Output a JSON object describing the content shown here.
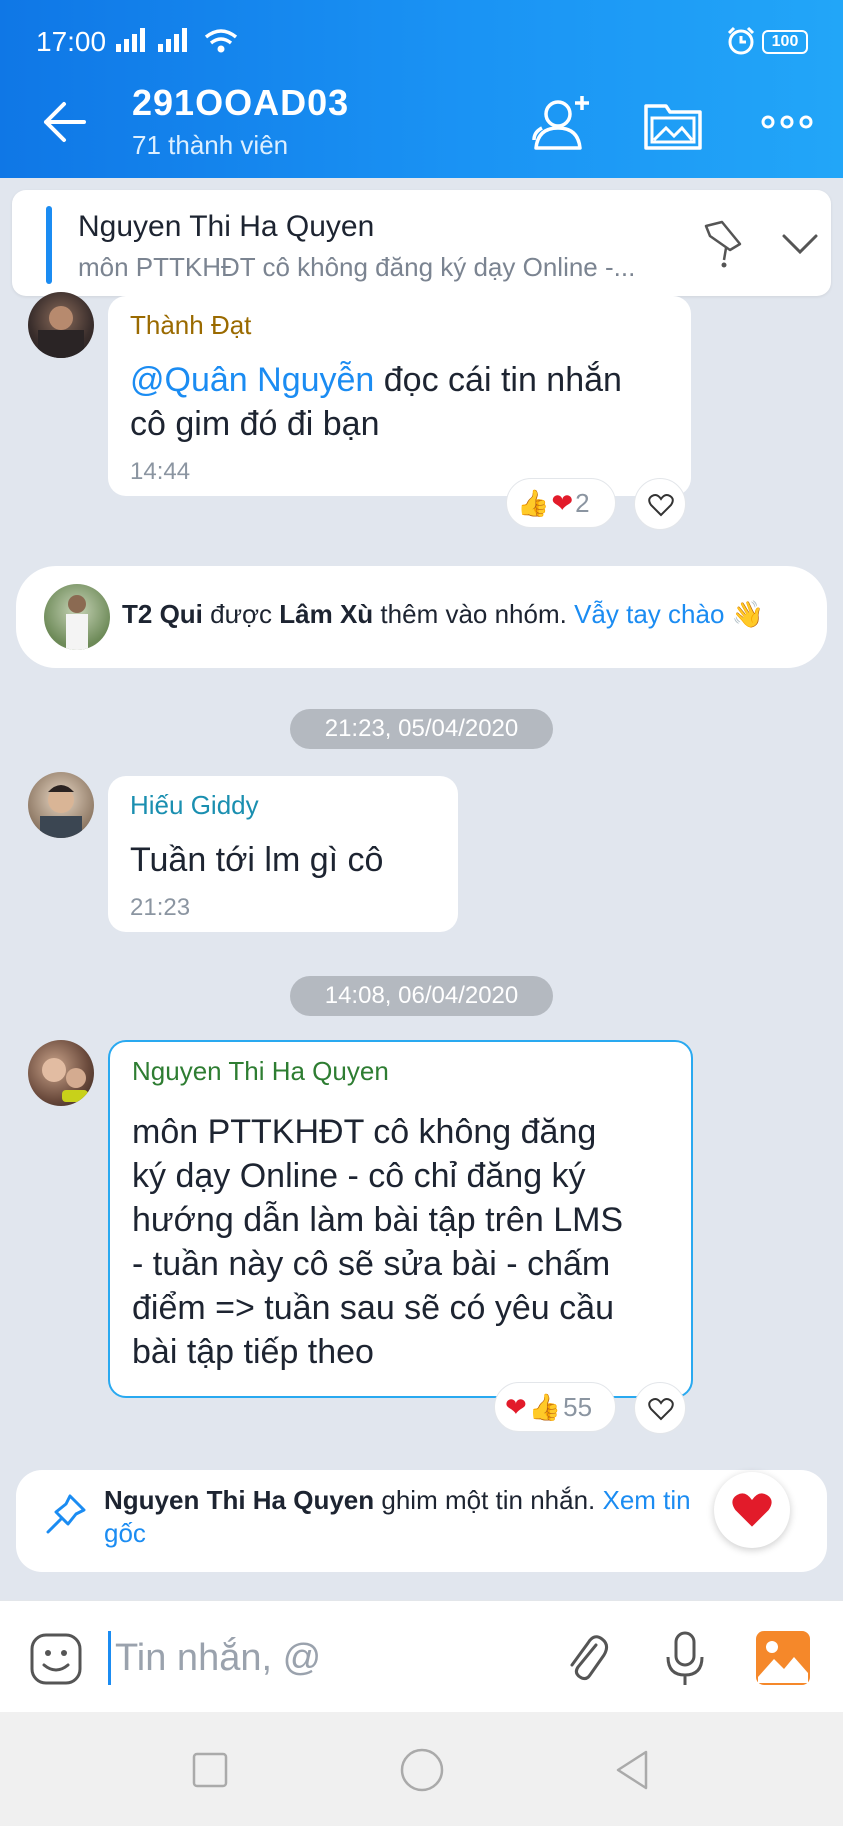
{
  "status_bar": {
    "time": "17:00",
    "battery": "100"
  },
  "header": {
    "title": "291OOAD03",
    "subtitle": "71 thành viên"
  },
  "pinned": {
    "name": "Nguyen Thi Ha Quyen",
    "text": "môn PTTKHĐT cô không đăng ký dạy Online -..."
  },
  "messages": [
    {
      "sender": "Thành Đạt",
      "sender_color": "#9a6a00",
      "mention": "@Quân Nguyễn",
      "line1_rest": " đọc cái tin nhắn",
      "line2": "cô gim đó đi bạn",
      "time": "14:44",
      "reaction_count": "2"
    },
    {
      "sender": "Hiếu Giddy",
      "sender_color": "#1a8fb0",
      "text": "Tuần tới lm gì cô",
      "time": "21:23"
    },
    {
      "sender": "Nguyen Thi Ha Quyen",
      "sender_color": "#2e7d32",
      "lines": [
        "môn PTTKHĐT cô không đăng",
        "ký dạy Online - cô chỉ đăng ký",
        "hướng dẫn làm bài tập trên LMS",
        "- tuần này cô sẽ sửa bài - chấm",
        "điểm => tuần sau sẽ có yêu cầu",
        "bài tập tiếp theo"
      ],
      "reaction_count": "55"
    }
  ],
  "system_join": {
    "actor": "T2 Qui",
    "verb": " được ",
    "by": "Lâm Xù",
    "rest": " thêm vào nhóm. ",
    "link": "Vẫy tay chào",
    "emoji": "👋"
  },
  "date_pills": [
    "21:23, 05/04/2020",
    "14:08, 06/04/2020"
  ],
  "system_pin": {
    "actor": "Nguyen Thi Ha Quyen",
    "rest": " ghim một tin nhắn. ",
    "link_line1": "Xem tin",
    "link_line2": "gốc"
  },
  "composer": {
    "placeholder": "Tin nhắn, @"
  },
  "colors": {
    "accent": "#1b8cf2",
    "header_start": "#0f77e6",
    "header_end": "#22a6f8"
  }
}
